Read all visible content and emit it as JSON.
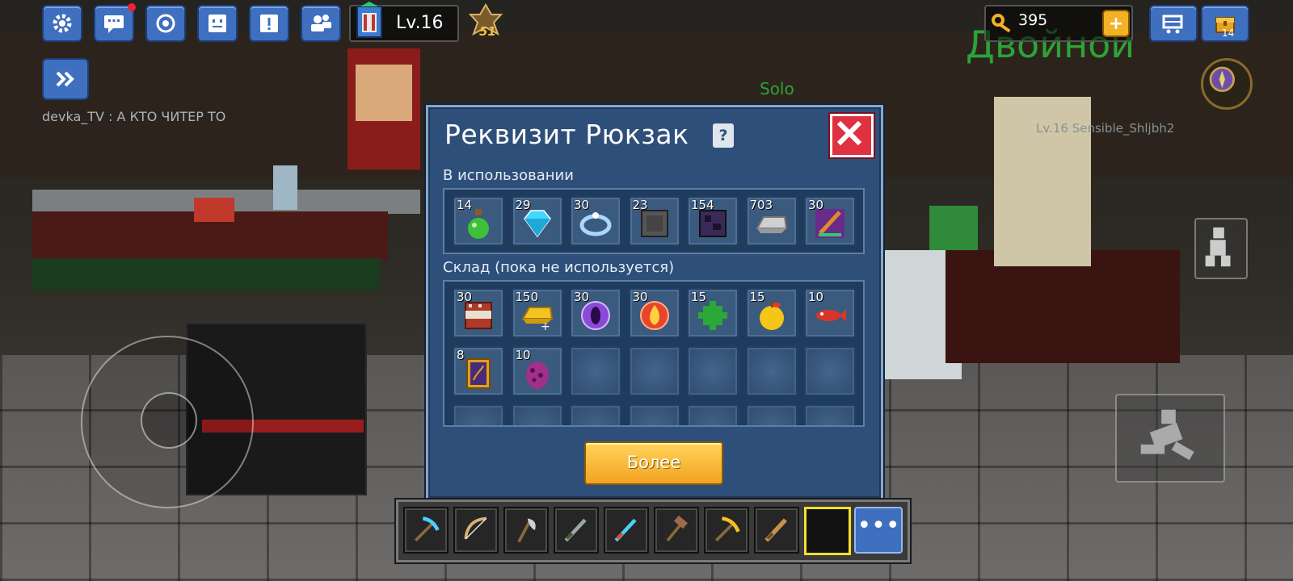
{
  "hud": {
    "level": "Lv.16",
    "rank": "51",
    "keys": "395",
    "add_keys": "+",
    "chest_count": "14",
    "buttons": [
      "gear-icon",
      "chat-icon",
      "target-icon",
      "face-icon",
      "alert-icon",
      "friends-icon"
    ]
  },
  "chat": {
    "line": "devka_TV : А КТО ЧИТЕР ТО"
  },
  "world": {
    "team_label": "Двойной",
    "mode_label": "Solo",
    "enemy_tag": "Lv.16 Sensible_Shljbh2"
  },
  "modal": {
    "title": "Реквизит Рюкзак",
    "help": "?",
    "in_use_label": "В использовании",
    "storage_label": "Склад (пока не используется)",
    "more_button": "Более",
    "in_use": [
      {
        "count": "14",
        "icon": "potion-icon",
        "color": "#3fbf3a"
      },
      {
        "count": "29",
        "icon": "diamond-icon",
        "color": "#3fd8ff"
      },
      {
        "count": "30",
        "icon": "ring-icon",
        "color": "#a8d8ff"
      },
      {
        "count": "23",
        "icon": "stone-block-icon",
        "color": "#555555"
      },
      {
        "count": "154",
        "icon": "obsidian-block-icon",
        "color": "#3a2a5a"
      },
      {
        "count": "703",
        "icon": "iron-ingot-icon",
        "color": "#d0d0d0"
      },
      {
        "count": "30",
        "icon": "flame-sword-icon",
        "color": "#e08a2a"
      }
    ],
    "storage": [
      {
        "count": "30",
        "icon": "tnt-block-icon",
        "color": "#b03a2a"
      },
      {
        "count": "150",
        "icon": "gold-ingot-icon",
        "color": "#f3c320"
      },
      {
        "count": "30",
        "icon": "void-orb-icon",
        "color": "#8a4ad8"
      },
      {
        "count": "30",
        "icon": "fire-orb-icon",
        "color": "#e8452a"
      },
      {
        "count": "15",
        "icon": "green-puzzle-icon",
        "color": "#2aa838"
      },
      {
        "count": "15",
        "icon": "golden-apple-icon",
        "color": "#f5c518"
      },
      {
        "count": "10",
        "icon": "red-fish-icon",
        "color": "#d8362a"
      },
      {
        "count": "8",
        "icon": "spell-book-icon",
        "color": "#e0a020"
      },
      {
        "count": "10",
        "icon": "dragon-egg-icon",
        "color": "#a0308a"
      }
    ]
  },
  "hotbar": {
    "items": [
      "pickaxe-diamond-icon",
      "bow-icon",
      "axe-icon",
      "dark-sword-icon",
      "ice-sword-icon",
      "hammer-icon",
      "golden-pickaxe-icon",
      "wooden-sword-icon",
      "empty-slot"
    ],
    "more": "•••"
  }
}
